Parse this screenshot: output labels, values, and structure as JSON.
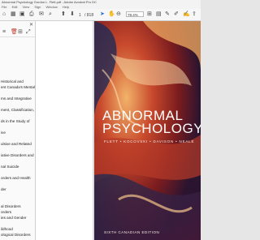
{
  "window": {
    "title": "Abnormal Psychology Gordon L. Flett.pdf - Adobe Acrobat Pro DC"
  },
  "menu": {
    "items": [
      "File",
      "Edit",
      "View",
      "Sign",
      "Window",
      "Help"
    ]
  },
  "toolbar": {
    "page_current": "1",
    "page_total": "/ 818",
    "zoom": "78.4%"
  },
  "bookmarks": [
    "Historical and",
    "ent Canada's Mental",
    "",
    "ms and Integrative",
    "",
    "ment, Classification,",
    "",
    "ds in the Study of",
    "",
    "ive",
    "",
    "ulsive and Related",
    "",
    "iative Disorders and",
    "",
    "nal Suicide",
    "",
    "orders and Health",
    "",
    "der",
    "",
    "",
    "al Disorders",
    "orders",
    "ies and Gender",
    "",
    "ildhood",
    "ological Disorders",
    "",
    "Sleep in"
  ],
  "cover": {
    "title_line1": "ABNORMAL",
    "title_line2": "PSYCHOLOGY",
    "authors": "FLETT  •  KOCOVSKI  •  DAVISON  •  NEALE",
    "edition": "SIXTH CANADIAN EDITION"
  }
}
